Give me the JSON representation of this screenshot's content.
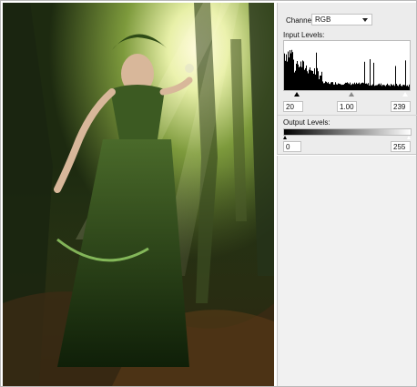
{
  "panel": {
    "channel_label": "Channel:",
    "channel_value": "RGB",
    "input_levels_label": "Input Levels:",
    "input_black": "20",
    "input_gamma": "1.00",
    "input_white": "239",
    "output_levels_label": "Output Levels:",
    "output_black": "0",
    "output_white": "255"
  },
  "icons": {
    "channel_dropdown": "chevron-down-icon",
    "slider_handle": "triangle-up-icon"
  },
  "colors": {
    "panel_bg": "#ececec",
    "field_bg": "#ffffff",
    "photo_dominant": "#2f4a18"
  }
}
